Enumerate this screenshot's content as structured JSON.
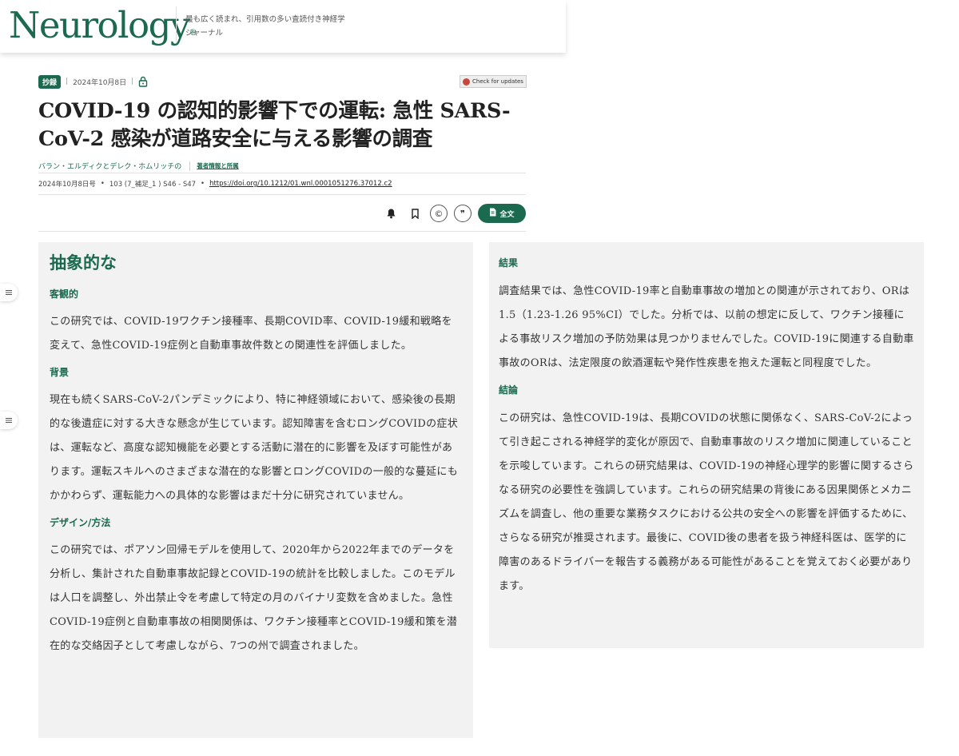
{
  "header": {
    "logo": "Neurology",
    "logo_mark": "®",
    "tagline": "最も広く読まれ、引用数の多い査読付き神経学ジャーナル"
  },
  "meta": {
    "badge": "抄録",
    "sep": "|",
    "date": "2024年10月8日",
    "check_updates": "Check for updates"
  },
  "article": {
    "title": "COVID-19 の認知的影響下での運転: 急性 SARS-CoV-2 感染が道路安全に与える影響の調査",
    "authors": "バラン・エルディクとデレク・ホムリッチの",
    "affiliations": "著者情報と所属",
    "issue_date": "2024年10月8日号",
    "bullet": "•",
    "volume": "103 (7_補足_1 ) S46 - S47",
    "doi": "https://doi.org/10.1212/01.wnl.0001051276.37012.c2"
  },
  "tools": {
    "copyright_symbol": "©",
    "quote_symbol": "❞",
    "fulltext_label": "全文",
    "icons": [
      "bell-icon",
      "bookmark-icon",
      "copyright-icon",
      "quote-icon",
      "document-icon"
    ]
  },
  "colors": {
    "brand_green": "#1b6a4f",
    "panel_bg": "#f2f2f2"
  },
  "abstract": {
    "heading": "抽象的な",
    "objective_h": "客観的",
    "objective": "この研究では、COVID-19ワクチン接種率、長期COVID率、COVID-19緩和戦略を変えて、急性COVID-19症例と自動車事故件数との関連性を評価しました。",
    "background_h": "背景",
    "background": "現在も続くSARS-CoV-2パンデミックにより、特に神経領域において、感染後の長期的な後遺症に対する大きな懸念が生じています。認知障害を含むロングCOVIDの症状は、運転など、高度な認知機能を必要とする活動に潜在的に影響を及ぼす可能性があります。運転スキルへのさまざまな潜在的な影響とロングCOVIDの一般的な蔓延にもかかわらず、運転能力への具体的な影響はまだ十分に研究されていません。",
    "design_h": "デザイン/方法",
    "design": "この研究では、ポアソン回帰モデルを使用して、2020年から2022年までのデータを分析し、集計された自動車事故記録とCOVID-19の統計を比較しました。このモデルは人口を調整し、外出禁止令を考慮して特定の月のバイナリ変数を含めました。急性COVID-19症例と自動車事故の相関関係は、ワクチン接種率とCOVID-19緩和策を潜在的な交絡因子として考慮しながら、7つの州で調査されました。",
    "results_h": "結果",
    "results": "調査結果では、急性COVID-19率と自動車事故の増加との関連が示されており、ORは1.5（1.23-1.26 95%CI）でした。分析では、以前の想定に反して、ワクチン接種による事故リスク増加の予防効果は見つかりませんでした。COVID-19に関連する自動車事故のORは、法定限度の飲酒運転や発作性疾患を抱えた運転と同程度でした。",
    "conclusion_h": "結論",
    "conclusion": "この研究は、急性COVID-19は、長期COVIDの状態に関係なく、SARS-CoV-2によって引き起こされる神経学的変化が原因で、自動車事故のリスク増加に関連していることを示唆しています。これらの研究結果は、COVID-19の神経心理学的影響に関するさらなる研究の必要性を強調しています。これらの研究結果の背後にある因果関係とメカニズムを調査し、他の重要な業務タスクにおける公共の安全への影響を評価するために、さらなる研究が推奨されます。最後に、COVID後の患者を扱う神経科医は、医学的に障害のあるドライバーを報告する義務がある可能性があることを覚えておく必要があります。"
  }
}
